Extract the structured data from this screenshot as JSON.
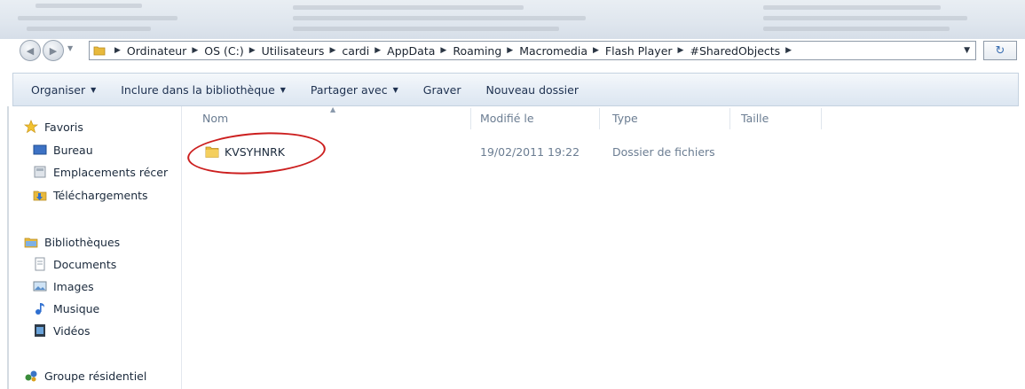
{
  "address_bar": {
    "crumbs": [
      "Ordinateur",
      "OS (C:)",
      "Utilisateurs",
      "cardi",
      "AppData",
      "Roaming",
      "Macromedia",
      "Flash Player",
      "#SharedObjects"
    ]
  },
  "toolbar": {
    "organize": "Organiser",
    "include": "Inclure dans la bibliothèque",
    "share": "Partager avec",
    "burn": "Graver",
    "new_folder": "Nouveau dossier"
  },
  "sidebar": {
    "favorites": "Favoris",
    "favorites_items": [
      "Bureau",
      "Emplacements récer",
      "Téléchargements"
    ],
    "libraries": "Bibliothèques",
    "libraries_items": [
      "Documents",
      "Images",
      "Musique",
      "Vidéos"
    ],
    "homegroup": "Groupe résidentiel"
  },
  "columns": {
    "name": "Nom",
    "modified": "Modifié le",
    "type": "Type",
    "size": "Taille"
  },
  "files": [
    {
      "name": "KVSYHNRK",
      "modified": "19/02/2011 19:22",
      "type": "Dossier de fichiers",
      "size": ""
    }
  ],
  "colors": {
    "highlight_circle": "#cc1f1f",
    "toolbar_text": "#1e3150",
    "folder_yellow": "#e8b93c"
  },
  "icons": [
    "back-icon",
    "forward-icon",
    "folder-icon",
    "refresh-icon",
    "star-icon",
    "desktop-icon",
    "recent-places-icon",
    "downloads-icon",
    "library-icon",
    "document-icon",
    "image-icon",
    "music-icon",
    "video-icon",
    "homegroup-icon"
  ]
}
